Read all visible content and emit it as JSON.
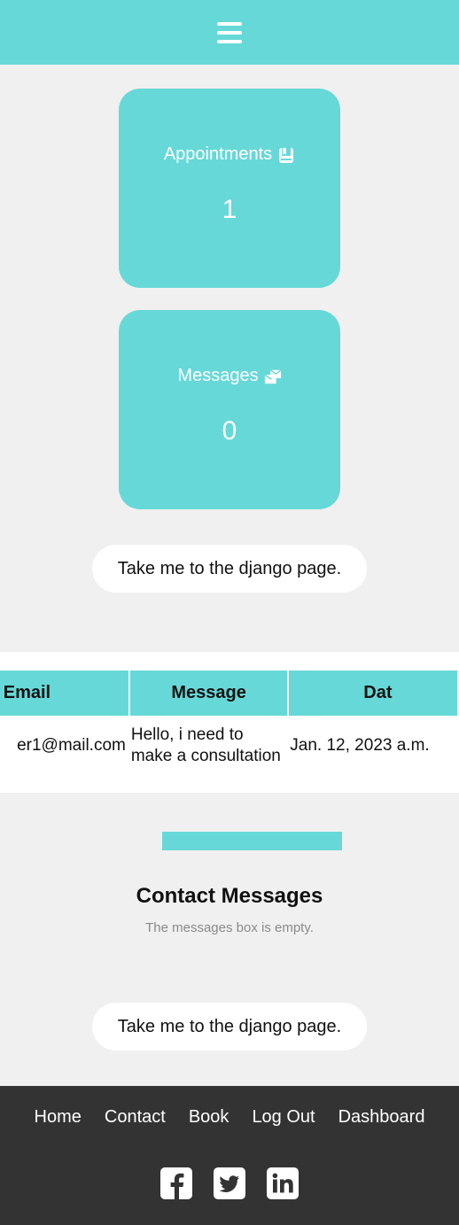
{
  "navbar": {
    "menu_icon": "hamburger-icon",
    "color": "#67d8d8"
  },
  "stats": [
    {
      "title": "Appointments",
      "icon": "calendar-icon",
      "value": "1"
    },
    {
      "title": "Messages",
      "icon": "envelopes-icon",
      "value": "0"
    }
  ],
  "django_link_label": "Take me to the django page.",
  "table": {
    "headers": {
      "email": "Email",
      "message": "Message",
      "date": "Dat"
    },
    "rows": [
      {
        "email": "er1@mail.com",
        "message": "Hello, i need to make a consultation",
        "date": "Jan. 12, 2023 a.m."
      }
    ]
  },
  "contact": {
    "title": "Contact Messages",
    "empty_text": "The messages box is empty."
  },
  "footer": {
    "nav": [
      "Home",
      "Contact",
      "Book",
      "Log Out",
      "Dashboard"
    ],
    "social": [
      "facebook-icon",
      "twitter-icon",
      "linkedin-icon"
    ]
  },
  "colors": {
    "accent": "#67d8d8",
    "footer_bg": "#333333",
    "page_bg": "#f0f0f0"
  }
}
